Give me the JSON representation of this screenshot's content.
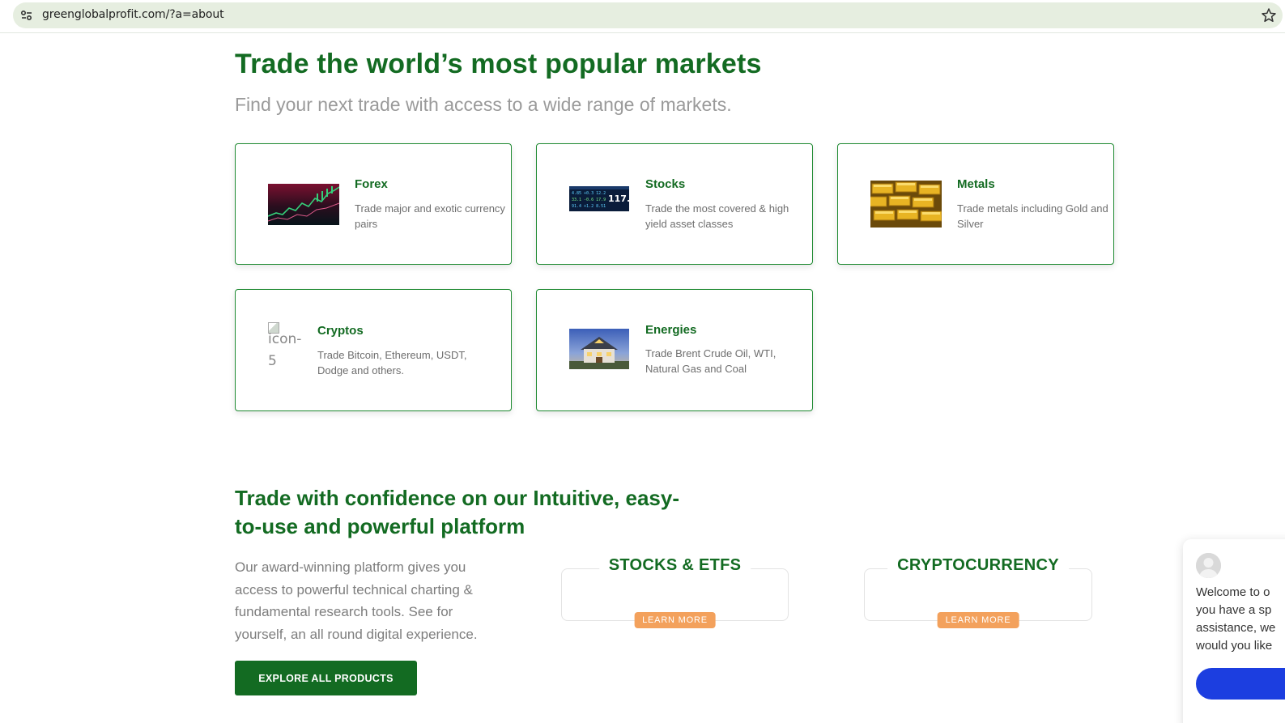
{
  "browser": {
    "url": "greenglobalprofit.com/?a=about"
  },
  "hero": {
    "title": "Trade the world’s most popular markets",
    "subtitle": "Find your next trade with access to a wide range of markets."
  },
  "markets": [
    {
      "title": "Forex",
      "description": "Trade major and exotic currency pairs"
    },
    {
      "title": "Stocks",
      "description": "Trade the most covered & high yield asset classes"
    },
    {
      "title": "Metals",
      "description": "Trade metals including Gold and Silver"
    },
    {
      "title": "Cryptos",
      "description": "Trade Bitcoin, Ethereum, USDT, Dodge and others.",
      "broken_image_alt_1": "icon-",
      "broken_image_alt_2": "5"
    },
    {
      "title": "Energies",
      "description": "Trade Brent Crude Oil, WTI, Natural Gas and Coal"
    }
  ],
  "platform": {
    "title": "Trade with confidence on our Intuitive, easy-to-use and powerful platform",
    "description": "Our award-winning platform gives you access to powerful technical charting & fundamental research tools. See for yourself, an all round digital experience.",
    "explore_label": "EXPLORE ALL PRODUCTS",
    "products": [
      {
        "title": "STOCKS & ETFS",
        "button": "LEARN MORE"
      },
      {
        "title": "CRYPTOCURRENCY",
        "button": "LEARN MORE"
      }
    ]
  },
  "chat": {
    "line1": "Welcome to o",
    "line2": "you have a sp",
    "line3": "assistance, we",
    "line4": "would you like"
  },
  "colors": {
    "brand_green": "#136b22",
    "accent_orange": "#f3a15c",
    "chat_blue": "#1c3ee0"
  }
}
